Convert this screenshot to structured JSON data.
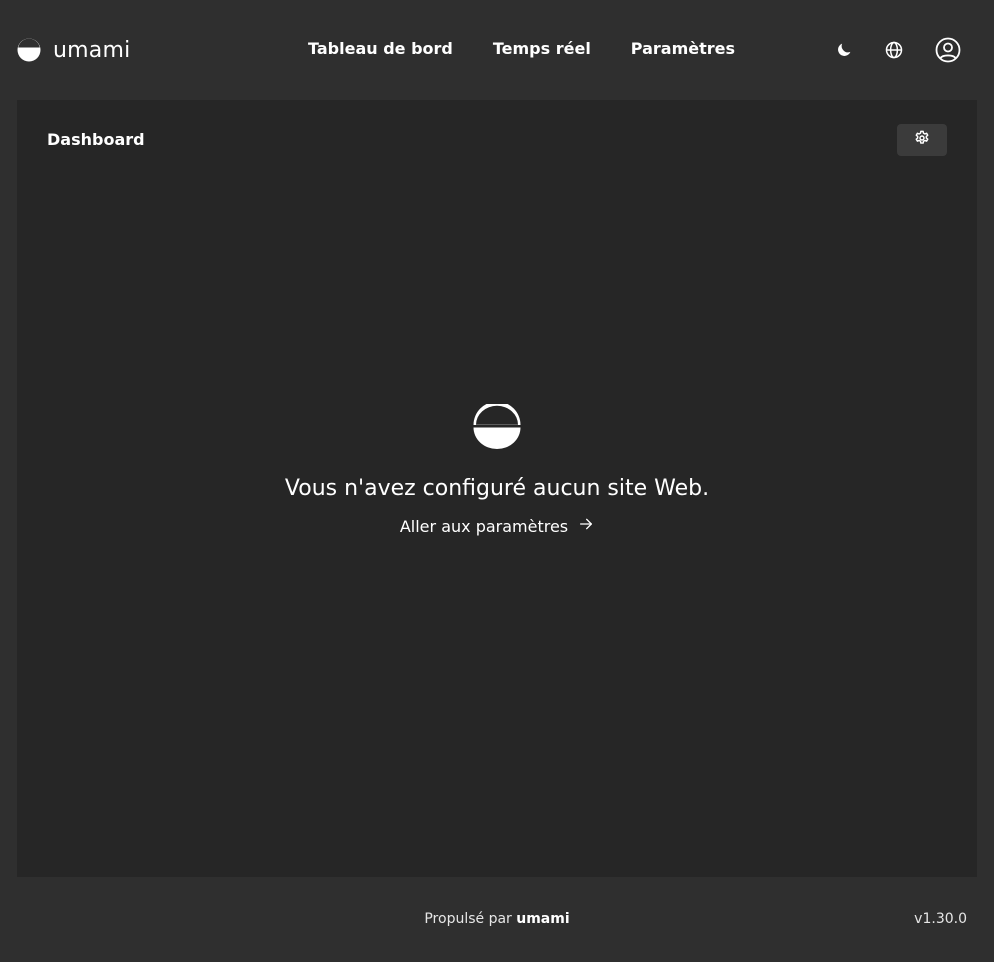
{
  "brand": {
    "name": "umami",
    "icon": "umami-logo-icon"
  },
  "nav": {
    "dashboard": "Tableau de bord",
    "realtime": "Temps réel",
    "settings": "Paramètres"
  },
  "header_icons": [
    "moon-icon",
    "globe-icon",
    "user-icon"
  ],
  "panel": {
    "title": "Dashboard",
    "settings_icon": "gear-icon"
  },
  "empty_state": {
    "message": "Vous n'avez configuré aucun site Web.",
    "link_label": "Aller aux paramètres",
    "link_icon": "arrow-right-icon"
  },
  "footer": {
    "powered_by": "Propulsé par ",
    "powered_by_name": "umami",
    "version": "v1.30.0"
  },
  "colors": {
    "background": "#2f2f2f",
    "panel": "#262626",
    "button": "#3b3b3b",
    "text": "#ffffff"
  }
}
